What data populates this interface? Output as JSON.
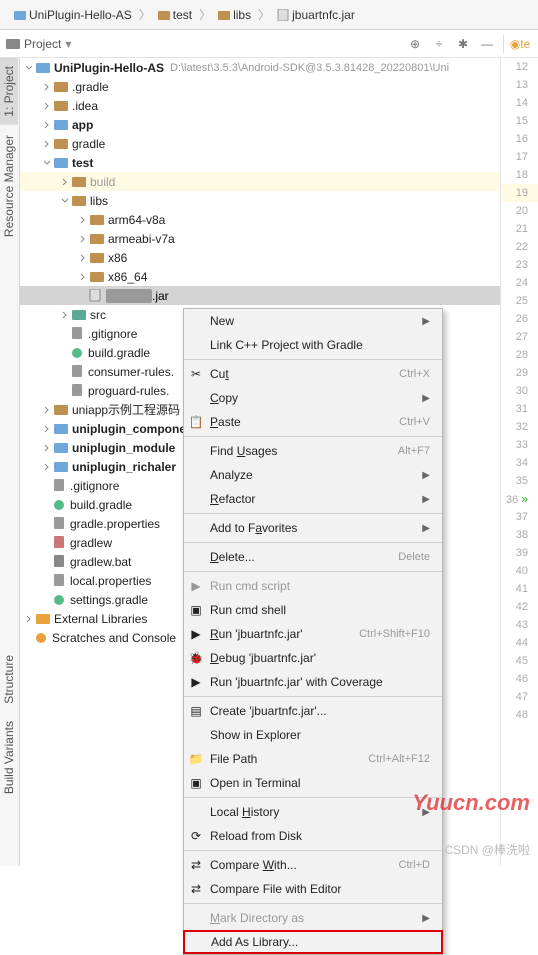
{
  "breadcrumb": [
    "UniPlugin-Hello-AS",
    "test",
    "libs",
    "jbuartnfc.jar"
  ],
  "project_panel": {
    "label": "Project"
  },
  "tabs": {
    "right": "te"
  },
  "side_tabs": [
    "1: Project",
    "Resource Manager",
    "Structure",
    "Build Variants"
  ],
  "line_numbers": [
    12,
    13,
    14,
    15,
    16,
    17,
    18,
    19,
    20,
    21,
    22,
    23,
    24,
    25,
    26,
    27,
    28,
    29,
    30,
    31,
    32,
    33,
    34,
    35,
    36,
    37,
    38,
    39,
    40,
    41,
    42,
    43,
    44,
    45,
    46,
    47,
    48
  ],
  "tree": {
    "root": {
      "name": "UniPlugin-Hello-AS",
      "path": "D:\\latest\\3.5.3\\Android-SDK@3.5.3.81428_20220801\\Uni"
    },
    "items": [
      ".gradle",
      ".idea",
      "app",
      "gradle",
      "test",
      "build",
      "libs",
      "arm64-v8a",
      "armeabi-v7a",
      "x86",
      "x86_64",
      "__.jar",
      "src",
      ".gitignore",
      "build.gradle",
      "consumer-rules.",
      "proguard-rules.",
      "uniapp示例工程源码",
      "uniplugin_compone",
      "uniplugin_module",
      "uniplugin_richaler",
      ".gitignore",
      "build.gradle",
      "gradle.properties",
      "gradlew",
      "gradlew.bat",
      "local.properties",
      "settings.gradle",
      "External Libraries",
      "Scratches and Console"
    ]
  },
  "menu": [
    {
      "t": "New",
      "sub": true
    },
    {
      "t": "Link C++ Project with Gradle"
    },
    {
      "sep": true
    },
    {
      "t": "Cut",
      "sc": "Ctrl+X",
      "ic": "cut",
      "u": 2
    },
    {
      "t": "Copy",
      "sub": true,
      "u": 0
    },
    {
      "t": "Paste",
      "sc": "Ctrl+V",
      "ic": "paste",
      "u": 0
    },
    {
      "sep": true
    },
    {
      "t": "Find Usages",
      "sc": "Alt+F7",
      "u": 5
    },
    {
      "t": "Analyze",
      "sub": true
    },
    {
      "t": "Refactor",
      "sub": true,
      "u": 0
    },
    {
      "sep": true
    },
    {
      "t": "Add to Favorites",
      "sub": true,
      "u": 8
    },
    {
      "sep": true
    },
    {
      "t": "Delete...",
      "sc": "Delete",
      "u": 0
    },
    {
      "sep": true
    },
    {
      "t": "Run cmd script",
      "dis": true,
      "ic": "run"
    },
    {
      "t": "Run cmd shell",
      "ic": "cmd"
    },
    {
      "t": "Run 'jbuartnfc.jar'",
      "sc": "Ctrl+Shift+F10",
      "ic": "run",
      "u": 0
    },
    {
      "t": "Debug 'jbuartnfc.jar'",
      "ic": "debug",
      "u": 0
    },
    {
      "t": "Run 'jbuartnfc.jar' with Coverage",
      "ic": "run"
    },
    {
      "sep": true
    },
    {
      "t": "Create 'jbuartnfc.jar'...",
      "ic": "cfg"
    },
    {
      "t": "Show in Explorer"
    },
    {
      "t": "File Path",
      "sc": "Ctrl+Alt+F12",
      "ic": "path"
    },
    {
      "t": "Open in Terminal",
      "ic": "term"
    },
    {
      "sep": true
    },
    {
      "t": "Local History",
      "sub": true,
      "u": 6
    },
    {
      "t": "Reload from Disk",
      "ic": "reload"
    },
    {
      "sep": true
    },
    {
      "t": "Compare With...",
      "sc": "Ctrl+D",
      "ic": "diff",
      "u": 8
    },
    {
      "t": "Compare File with Editor",
      "ic": "diff"
    },
    {
      "sep": true
    },
    {
      "t": "Mark Directory as",
      "sub": true,
      "dis": true,
      "u": 0
    },
    {
      "t": "Add As Library...",
      "box": true
    }
  ],
  "watermark1": "Yuucn.com",
  "watermark2": "CSDN @棒洗啦"
}
